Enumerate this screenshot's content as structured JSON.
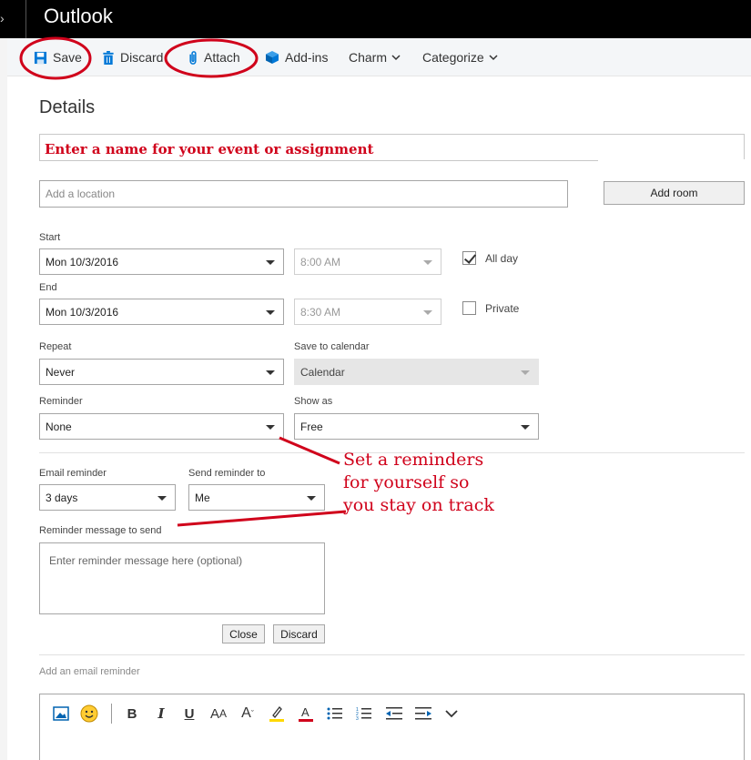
{
  "app": {
    "title": "Outlook"
  },
  "toolbar": {
    "save": "Save",
    "discard": "Discard",
    "attach": "Attach",
    "addins": "Add-ins",
    "charm": "Charm",
    "categorize": "Categorize"
  },
  "details": {
    "heading": "Details",
    "name_annotation": "Enter a name for your event or assignment",
    "location_placeholder": "Add a location",
    "add_room": "Add room"
  },
  "start": {
    "label": "Start",
    "date": "Mon 10/3/2016",
    "time": "8:00 AM"
  },
  "end": {
    "label": "End",
    "date": "Mon 10/3/2016",
    "time": "8:30 AM"
  },
  "all_day": {
    "label": "All day",
    "checked": true
  },
  "private": {
    "label": "Private",
    "checked": false
  },
  "repeat": {
    "label": "Repeat",
    "value": "Never"
  },
  "save_to_calendar": {
    "label": "Save to calendar",
    "value": "Calendar"
  },
  "reminder": {
    "label": "Reminder",
    "value": "None"
  },
  "show_as": {
    "label": "Show as",
    "value": "Free"
  },
  "email_reminder": {
    "label": "Email reminder",
    "value": "3 days"
  },
  "send_reminder_to": {
    "label": "Send reminder to",
    "value": "Me"
  },
  "reminder_message": {
    "label": "Reminder message to send",
    "placeholder": "Enter reminder message here (optional)"
  },
  "actions": {
    "close": "Close",
    "discard": "Discard"
  },
  "add_email_reminder": "Add an email reminder",
  "annotation": {
    "line1": "Set a reminders",
    "line2": "for yourself so",
    "line3": "you stay on track"
  },
  "colors": {
    "annotation_red": "#d0021b",
    "accent_blue": "#0078d7",
    "titlebar": "#000000"
  },
  "icons": [
    "save-icon",
    "trash-icon",
    "paperclip-icon",
    "addins-cube-icon",
    "image-icon",
    "emoji-icon",
    "bold-icon",
    "italic-icon",
    "underline-icon",
    "font-size-icon",
    "font-size-decrease-icon",
    "highlight-icon",
    "font-color-icon",
    "bullets-icon",
    "numbering-icon",
    "outdent-icon",
    "indent-icon",
    "more-chevron-icon"
  ]
}
